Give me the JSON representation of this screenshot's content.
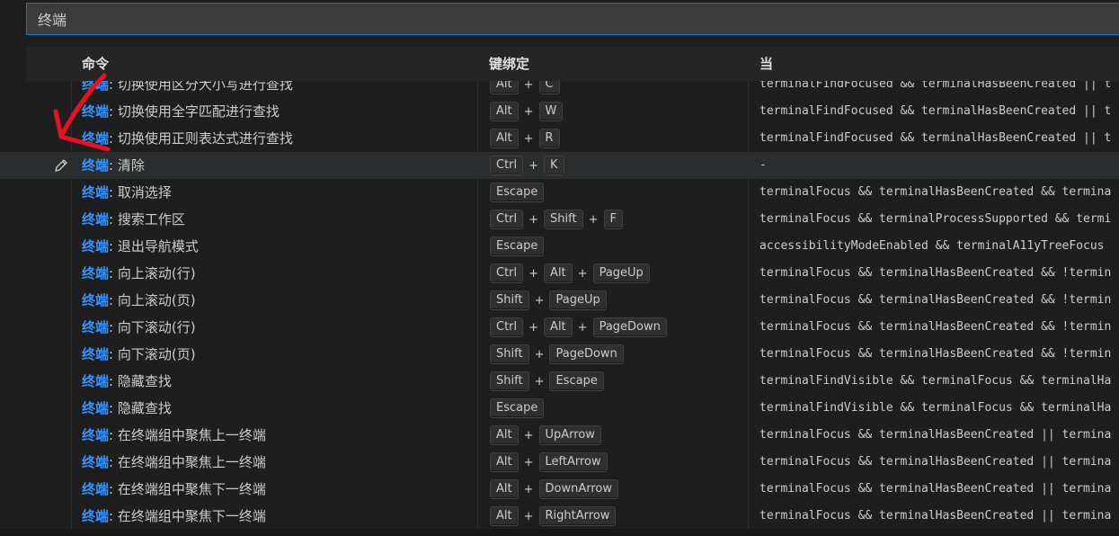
{
  "search": {
    "value": "终端"
  },
  "header": {
    "command": "命令",
    "keybinding": "键绑定",
    "when": "当"
  },
  "category": "终端",
  "rows": [
    {
      "label": "切换使用区分大小写进行查找",
      "keys": [
        "Alt",
        "C"
      ],
      "when": "terminalFindFocused && terminalHasBeenCreated || t"
    },
    {
      "label": "切换使用全字匹配进行查找",
      "keys": [
        "Alt",
        "W"
      ],
      "when": "terminalFindFocused && terminalHasBeenCreated || t"
    },
    {
      "label": "切换使用正则表达式进行查找",
      "keys": [
        "Alt",
        "R"
      ],
      "when": "terminalFindFocused && terminalHasBeenCreated || t"
    },
    {
      "label": "清除",
      "keys": [
        "Ctrl",
        "K"
      ],
      "when": "-"
    },
    {
      "label": "取消选择",
      "keys": [
        "Escape"
      ],
      "when": "terminalFocus && terminalHasBeenCreated && termina"
    },
    {
      "label": "搜索工作区",
      "keys": [
        "Ctrl",
        "Shift",
        "F"
      ],
      "when": "terminalFocus && terminalProcessSupported && termi"
    },
    {
      "label": "退出导航模式",
      "keys": [
        "Escape"
      ],
      "when": "accessibilityModeEnabled && terminalA11yTreeFocus"
    },
    {
      "label": "向上滚动(行)",
      "keys": [
        "Ctrl",
        "Alt",
        "PageUp"
      ],
      "when": "terminalFocus && terminalHasBeenCreated && !termin"
    },
    {
      "label": "向上滚动(页)",
      "keys": [
        "Shift",
        "PageUp"
      ],
      "when": "terminalFocus && terminalHasBeenCreated && !termin"
    },
    {
      "label": "向下滚动(行)",
      "keys": [
        "Ctrl",
        "Alt",
        "PageDown"
      ],
      "when": "terminalFocus && terminalHasBeenCreated && !termin"
    },
    {
      "label": "向下滚动(页)",
      "keys": [
        "Shift",
        "PageDown"
      ],
      "when": "terminalFocus && terminalHasBeenCreated && !termin"
    },
    {
      "label": "隐藏查找",
      "keys": [
        "Shift",
        "Escape"
      ],
      "when": "terminalFindVisible && terminalFocus && terminalHa"
    },
    {
      "label": "隐藏查找",
      "keys": [
        "Escape"
      ],
      "when": "terminalFindVisible && terminalFocus && terminalHa"
    },
    {
      "label": "在终端组中聚焦上一终端",
      "keys": [
        "Alt",
        "UpArrow"
      ],
      "when": "terminalFocus && terminalHasBeenCreated || termina"
    },
    {
      "label": "在终端组中聚焦上一终端",
      "keys": [
        "Alt",
        "LeftArrow"
      ],
      "when": "terminalFocus && terminalHasBeenCreated || termina"
    },
    {
      "label": "在终端组中聚焦下一终端",
      "keys": [
        "Alt",
        "DownArrow"
      ],
      "when": "terminalFocus && terminalHasBeenCreated || termina"
    },
    {
      "label": "在终端组中聚焦下一终端",
      "keys": [
        "Alt",
        "RightArrow"
      ],
      "when": "terminalFocus && terminalHasBeenCreated || termina"
    }
  ],
  "focused_row": 3,
  "icons": {
    "edit": "pencil-icon",
    "annotation": "red-arrow-annotation"
  },
  "colors": {
    "category": "#3794ff",
    "focus_border": "#007fd4",
    "annotation": "#e81123"
  }
}
